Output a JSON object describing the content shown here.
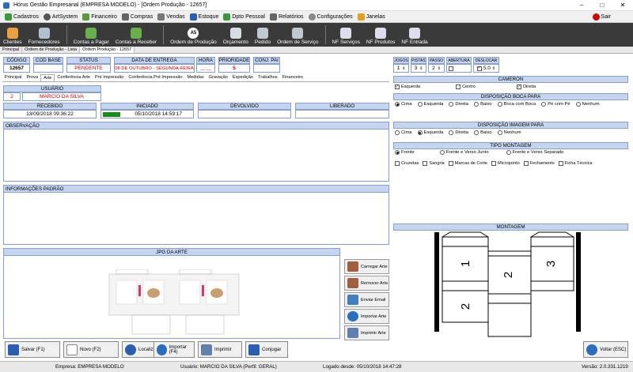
{
  "window": {
    "title": "Hórus Gestão Empresarial (EMPRESA MODELO) - [Ordem Produção - 12657]",
    "min": "–",
    "max": "□",
    "close": "✕"
  },
  "menu": [
    "Cadastros",
    "ArtSystem",
    "Financeiro",
    "Compras",
    "Vendas",
    "Estoque",
    "Dpto Pessoal",
    "Relatórios",
    "Configurações",
    "Janelas"
  ],
  "menu_exit": "Sair",
  "toolbar": [
    "Clientes",
    "Fornecedores",
    "Contas a Pagar",
    "Contas a Receber",
    "Ordem de Produção",
    "Orçamento",
    "Pedido",
    "Ordem de Serviço",
    "NF Serviços",
    "NF Produtos",
    "NF Entrada"
  ],
  "toolbar_badge": "A5",
  "doc_tabs": [
    "Principal",
    "Ordem de Produção - Lista",
    "Ordem Produção - 12657"
  ],
  "header_fields": {
    "codigo": {
      "label": "CÓDIGO",
      "value": "12657"
    },
    "cod_base": {
      "label": "COD BASE",
      "value": ""
    },
    "status": {
      "label": "STATUS",
      "value": "PENDENTE"
    },
    "data_entrega": {
      "label": "DATA DE ENTREGA",
      "value": "08 DE OUTUBRO - SEGUNDA-FEIRA"
    },
    "hora": {
      "label": "HORA",
      "value": "__:__"
    },
    "prioridade": {
      "label": "PRIORIDADE",
      "value": "5"
    },
    "conj_pai": {
      "label": "CONJ. PAI",
      "value": ""
    }
  },
  "sub_tabs": [
    "Principal",
    "Prova",
    "Arte",
    "Conferência Arte",
    "Pré Impressão",
    "Conferência Pré Impressão",
    "Medidas",
    "Gravação",
    "Expedição",
    "Trabalhos",
    "Financeiro"
  ],
  "usuario": {
    "label": "USUÁRIO",
    "code": "2",
    "name": "MARCIO DA SILVA"
  },
  "timeline": {
    "recebido": {
      "label": "RECEBIDO",
      "value": "13/09/2018 09:36:22"
    },
    "iniciado": {
      "label": "INICIADO",
      "value": "05/10/2018 14:59:17"
    },
    "devolvido": {
      "label": "DEVOLVIDO",
      "value": ""
    },
    "liberado": {
      "label": "LIBERADO",
      "value": ""
    }
  },
  "observacao_label": "OBSERVAÇÃO",
  "informacoes_label": "INFORMAÇÕES PADRÃO",
  "jpg_label": "JPG DA ARTE",
  "side_buttons": [
    "Carregar Arte",
    "Remover Arte",
    "Enviar Email",
    "Importar Arte",
    "Imprimir Arte"
  ],
  "right": {
    "jogos": {
      "label": "JOGOS",
      "value": "1"
    },
    "pistas": {
      "label": "PISTAS",
      "value": "3"
    },
    "passo": {
      "label": "PASSO",
      "value": "2"
    },
    "abertura": {
      "label": "ABERTURA",
      "value": ""
    },
    "deslocar": {
      "label": "DESLOCAR",
      "value": "5.0"
    },
    "cameron_label": "CAMERON",
    "cameron": [
      "Esquerda",
      "Centro",
      "Direita"
    ],
    "boca_label": "DISPOSIÇÃO BOCA PARA",
    "boca": [
      "Cima",
      "Esquerda",
      "Direita",
      "Baixo",
      "Boca com Boca",
      "Pé com Pé",
      "Nenhum"
    ],
    "imagem_label": "DISPOSIÇÃO IMAGEM PARA",
    "imagem": [
      "Cima",
      "Esquerda",
      "Direita",
      "Baixo",
      "Nenhum"
    ],
    "tipo_label": "TIPO MONTAGEM",
    "tipo": [
      "Frente",
      "Frente e Verso Junto",
      "Frente e Verso Separado"
    ],
    "extras": [
      "Cruzetas",
      "Sangria",
      "Marcas de Corte",
      "Microponto",
      "Fechamento",
      "Ficha Técnica"
    ],
    "montagem_label": "MONTAGEM",
    "montagem_nums": [
      "1",
      "2",
      "3",
      "2"
    ]
  },
  "bottom_buttons": [
    "Salvar (F1)",
    "Novo (F2)",
    "Localizar",
    "Importar (F4)",
    "Imprimir",
    "Conjugar"
  ],
  "back_button": "Voltar (ESC)",
  "statusbar": {
    "empresa": "Empresa: EMPRESA MODELO",
    "usuario": "Usuário: MARCIO DA SILVA (Perfil: GERAL)",
    "logado": "Logado desde: 05/10/2018 14:47:28",
    "versao": "Versão: 2.0.331.1219"
  },
  "colors": {
    "header_bg": "#c5d4ef",
    "toolbar_bg": "#3a3a3a",
    "accent_red": "#d00000",
    "progress_green": "#1a8a1a"
  }
}
